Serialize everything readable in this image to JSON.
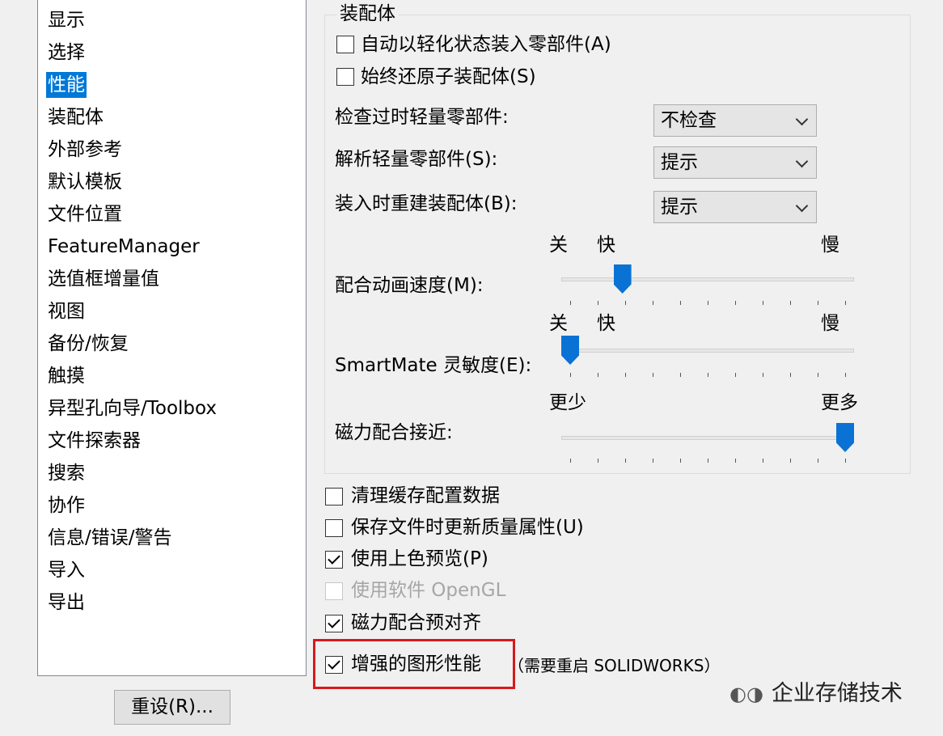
{
  "nav": {
    "items": [
      "显示",
      "选择",
      "性能",
      "装配体",
      "外部参考",
      "默认模板",
      "文件位置",
      "FeatureManager",
      "选值框增量值",
      "视图",
      "备份/恢复",
      "触摸",
      "异型孔向导/Toolbox",
      "文件探索器",
      "搜索",
      "协作",
      "信息/错误/警告",
      "导入",
      "导出"
    ],
    "selected_index": 2,
    "reset_label": "重设(R)..."
  },
  "assembly": {
    "title": "装配体",
    "auto_lightweight": {
      "label": "自动以轻化状态装入零部件(A)",
      "checked": false
    },
    "always_resolve": {
      "label": "始终还原子装配体(S)",
      "checked": false
    },
    "check_outdated": {
      "label": "检查过时轻量零部件:",
      "value": "不检查"
    },
    "resolve_lightweight": {
      "label": "解析轻量零部件(S):",
      "value": "提示"
    },
    "rebuild_on_load": {
      "label": "装入时重建装配体(B):",
      "value": "提示"
    },
    "mate_animation": {
      "label": "配合动画速度(M):",
      "tick_off": "关",
      "tick_fast": "快",
      "tick_slow": "慢",
      "value_fraction": 0.19
    },
    "smartmate": {
      "label": "SmartMate 灵敏度(E):",
      "tick_off": "关",
      "tick_fast": "快",
      "tick_slow": "慢",
      "value_fraction": 0.0
    },
    "magnetic_mate": {
      "label": "磁力配合接近:",
      "tick_less": "更少",
      "tick_more": "更多",
      "value_fraction": 1.0
    }
  },
  "options": [
    {
      "label": "清理缓存配置数据",
      "checked": false,
      "enabled": true
    },
    {
      "label": "保存文件时更新质量属性(U)",
      "checked": false,
      "enabled": true
    },
    {
      "label": "使用上色预览(P)",
      "checked": true,
      "enabled": true
    },
    {
      "label": "使用软件 OpenGL",
      "checked": false,
      "enabled": false
    },
    {
      "label": "磁力配合预对齐",
      "checked": true,
      "enabled": true
    },
    {
      "label": "增强的图形性能",
      "checked": true,
      "enabled": true
    }
  ],
  "restart_note": "（需要重启 SOLIDWORKS）",
  "watermark": {
    "icon": "wechat-icon",
    "text": "企业存储技术"
  },
  "colors": {
    "selection": "#0078d7",
    "slider_thumb": "#0a72d4",
    "highlight_border": "#d8191c"
  }
}
